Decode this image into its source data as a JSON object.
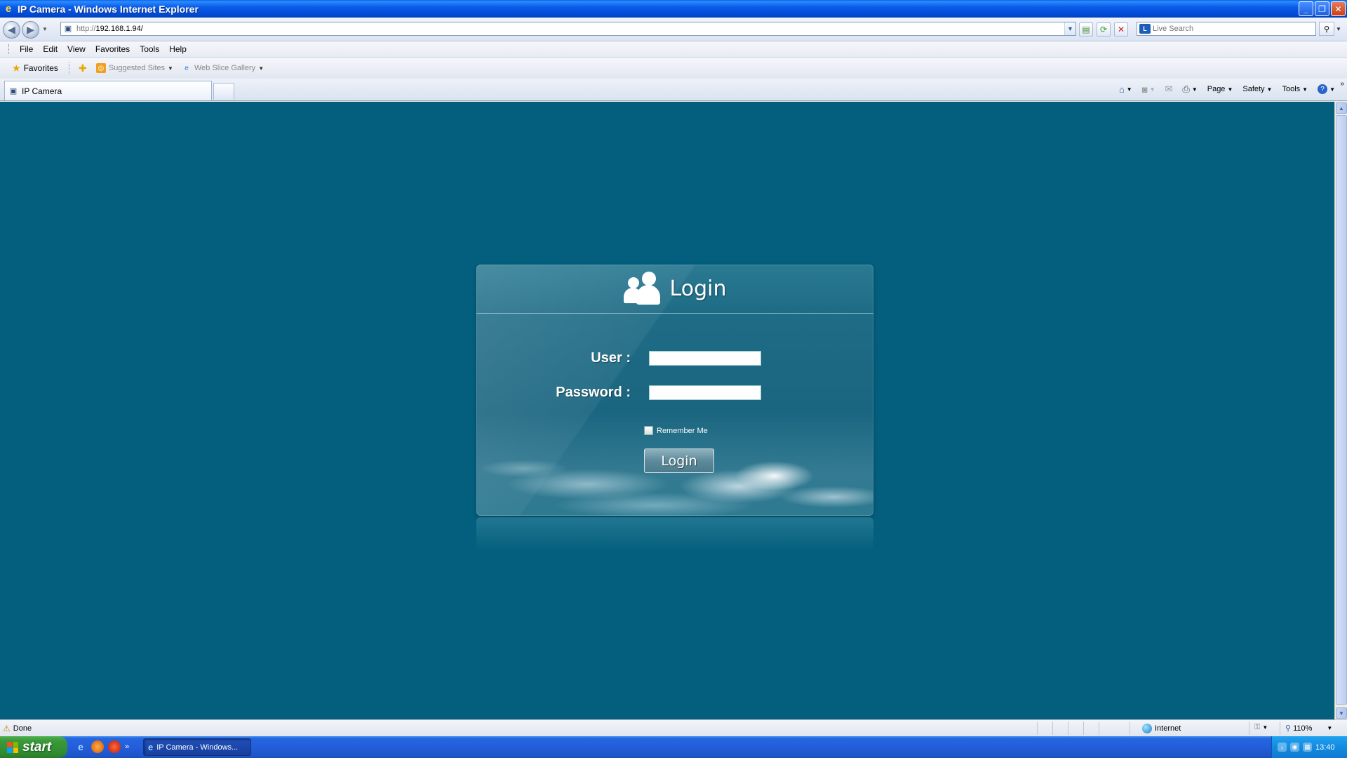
{
  "window": {
    "title": "IP Camera - Windows Internet Explorer",
    "buttons": {
      "minimize": "_",
      "maximize": "❐",
      "close": "✕"
    }
  },
  "address": {
    "proto": "http://",
    "host": "192.168.1.94/"
  },
  "search": {
    "placeholder": "Live Search"
  },
  "menu": [
    "File",
    "Edit",
    "View",
    "Favorites",
    "Tools",
    "Help"
  ],
  "favorites": {
    "label": "Favorites",
    "links": [
      "Suggested Sites",
      "Web Slice Gallery"
    ]
  },
  "tab": {
    "title": "IP Camera"
  },
  "commands": [
    "Page",
    "Safety",
    "Tools"
  ],
  "login": {
    "title": "Login",
    "user_label": "User :",
    "password_label": "Password :",
    "user_value": "",
    "password_value": "",
    "remember_label": "Remember Me",
    "remember_checked": false,
    "button": "Login"
  },
  "status": {
    "text": "Done",
    "zone": "Internet",
    "zoom": "110%"
  },
  "taskbar": {
    "start": "start",
    "task": "IP Camera - Windows...",
    "time": "13:40"
  },
  "colors": {
    "page_bg": "#035f7d",
    "panel_bg": "#1f6c86"
  }
}
